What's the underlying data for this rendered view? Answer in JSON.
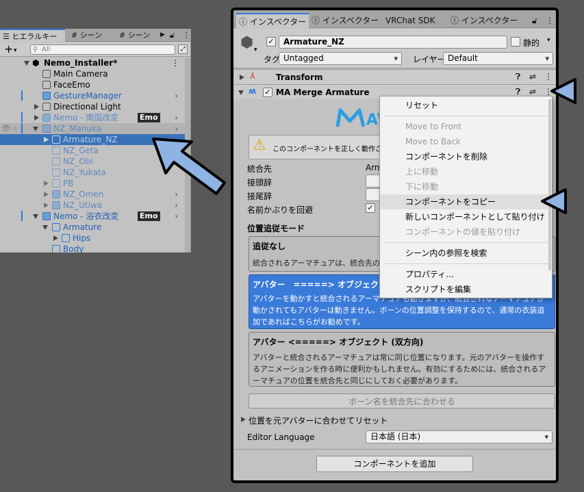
{
  "hierarchy": {
    "tabs": [
      "ヒエラルキー",
      "シーン",
      "シーン"
    ],
    "search_placeholder": "All",
    "rows": [
      {
        "label": "Nemo_Installer*",
        "bold": true
      },
      {
        "label": "Main Camera"
      },
      {
        "label": "FaceEmo"
      },
      {
        "label": "GestureManager"
      },
      {
        "label": "Directional Light"
      },
      {
        "label": "Nemo - 南国改変",
        "badge": "Emo"
      },
      {
        "label": "NZ_Manuka"
      },
      {
        "label": "Armature_NZ"
      },
      {
        "label": "NZ_Geta"
      },
      {
        "label": "NZ_Obi"
      },
      {
        "label": "NZ_Yukata"
      },
      {
        "label": "PB"
      },
      {
        "label": "NZ_Omen"
      },
      {
        "label": "NZ_Utiwa"
      },
      {
        "label": "Nemo - 浴衣改変",
        "badge": "Emo"
      },
      {
        "label": "Armature"
      },
      {
        "label": "Hips"
      },
      {
        "label": "Body"
      }
    ]
  },
  "inspector": {
    "tabs": [
      "インスペクター",
      "インスペクター",
      "VRChat SDK",
      "インスペクター"
    ],
    "object_name": "Armature_NZ",
    "static_label": "静的",
    "tag_label": "タグ",
    "tag_value": "Untagged",
    "layer_label": "レイヤー",
    "layer_value": "Default",
    "transform_label": "Transform",
    "component_label": "MA Merge Armature",
    "logo_text": "AV",
    "warning_text": "このコンポーネントを正しく動作させるには",
    "fields": {
      "merge_target": "統合先",
      "merge_target_value": "Arm",
      "prefix": "接頭辞",
      "suffix": "接尾辞",
      "avoid_name_collision": "名前かぶりを回避"
    },
    "position_mode_label": "位置追従モード",
    "modes": [
      {
        "title": "追従なし",
        "desc": "統合されるアーマチュアは、統合先のアー"
      },
      {
        "title": "アバター　=====> オブジェクト (片",
        "desc1": "アバターを動かすと統合されるアーマチュアも動きますが、統合されるアーマチュアが動かされてもアバターは動きません。ボーンの位置調整を保持するので、通常の衣装追加であればこちらがお勧めです。"
      },
      {
        "title": "アバター <=====> オブジェクト (双方向)",
        "desc1": "アバターと統合されるアーマチュアは常に同じ位置になります。元のアバターを操作するアニメーションを作る時に便利かもしれません。有効にするためには、統合されるアーマチュアの位置を統合先と同じにしておく必要があります。"
      }
    ],
    "adjust_names_button": "ボーン名を統合先に合わせる",
    "reset_foldout": "位置を元アバターに合わせてリセット",
    "editor_language_label": "Editor Language",
    "editor_language_value": "日本語 (日本)",
    "add_component_button": "コンポーネントを追加"
  },
  "context_menu": {
    "items": [
      {
        "label": "リセット",
        "enabled": true
      },
      {
        "label": "Move to Front",
        "enabled": false
      },
      {
        "label": "Move to Back",
        "enabled": false
      },
      {
        "label": "コンポーネントを削除",
        "enabled": true
      },
      {
        "label": "上に移動",
        "enabled": false
      },
      {
        "label": "下に移動",
        "enabled": false
      },
      {
        "label": "コンポーネントをコピー",
        "enabled": true,
        "highlighted": true
      },
      {
        "label": "新しいコンポーネントとして貼り付け",
        "enabled": true
      },
      {
        "label": "コンポーネントの値を貼り付け",
        "enabled": false
      },
      {
        "label": "シーン内の参照を検索",
        "enabled": true
      },
      {
        "label": "プロパティ...",
        "enabled": true
      },
      {
        "label": "スクリプトを編集",
        "enabled": true
      }
    ]
  },
  "colors": {
    "selection": "#3a72b8",
    "accent_blue": "#3a7ad9",
    "arrow_blue": "#8fb3e2"
  }
}
